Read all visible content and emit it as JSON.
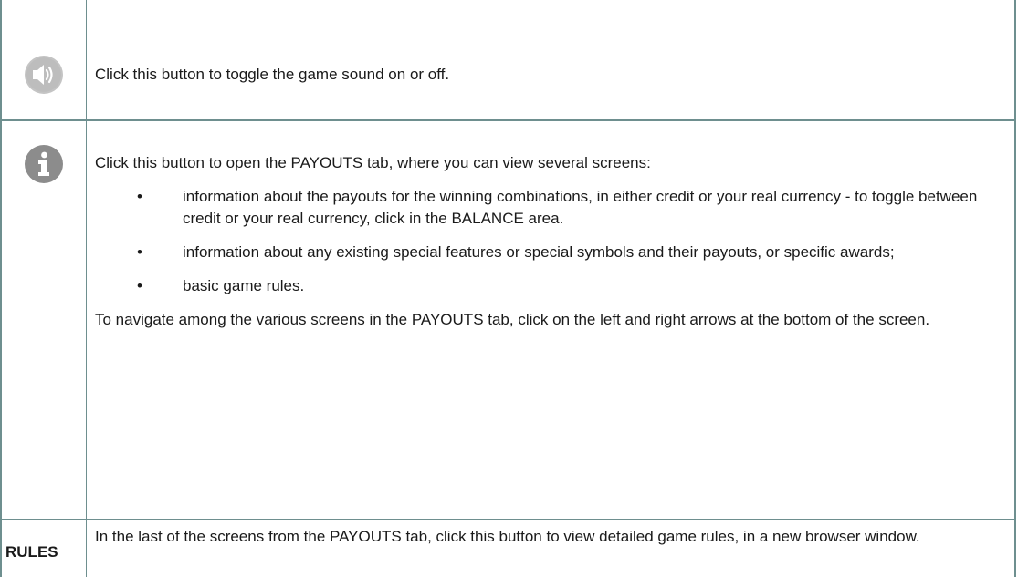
{
  "rows": [
    {
      "icon": "speaker-icon",
      "text": "Click this button to toggle the game sound on or off."
    },
    {
      "icon": "info-icon",
      "intro": "Click this button to open the PAYOUTS tab, where you can view several screens:",
      "bullets": [
        "information about the payouts for the winning combinations, in either credit or your real currency - to toggle between credit or your real currency, click in the BALANCE area.",
        "information about any existing special features or special symbols and their payouts, or specific awards;",
        "basic game rules."
      ],
      "outro": "To navigate among the various screens in the PAYOUTS tab, click on the left and right arrows at the bottom of the screen."
    },
    {
      "label": "RULES",
      "text": "In the last of the screens from the PAYOUTS tab, click this button to view detailed game rules, in a new browser window."
    }
  ],
  "colors": {
    "border": "#6e8f8f",
    "icon_fill": "#b7b7b7",
    "info_icon_fill": "#8c8c8c"
  }
}
